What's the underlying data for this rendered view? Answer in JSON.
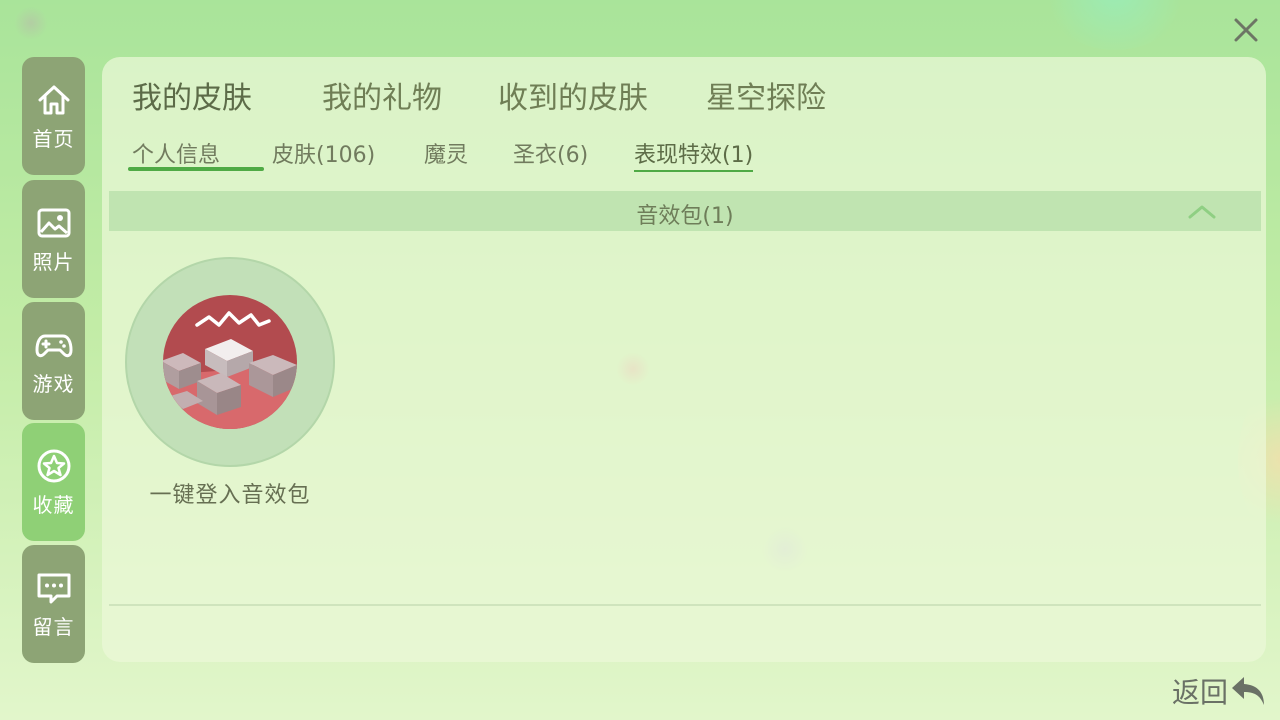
{
  "close_icon": "close-icon",
  "sidebar": {
    "items": [
      {
        "label": "首页",
        "icon": "home-icon"
      },
      {
        "label": "照片",
        "icon": "photo-icon"
      },
      {
        "label": "游戏",
        "icon": "gamepad-icon"
      },
      {
        "label": "收藏",
        "icon": "star-icon",
        "active": true
      },
      {
        "label": "留言",
        "icon": "message-icon"
      }
    ]
  },
  "tabs": [
    {
      "label": "我的皮肤",
      "active": true
    },
    {
      "label": "我的礼物"
    },
    {
      "label": "收到的皮肤"
    },
    {
      "label": "星空探险"
    }
  ],
  "subtabs": [
    {
      "label": "个人信息"
    },
    {
      "label": "皮肤(106)"
    },
    {
      "label": "魔灵"
    },
    {
      "label": "圣衣(6)"
    },
    {
      "label": "表现特效(1)",
      "active": true
    }
  ],
  "section": {
    "title": "音效包(1)",
    "icon": "chevron-up-icon"
  },
  "items": [
    {
      "label": "一键登入音效包",
      "icon": "sound-pack-icon"
    }
  ],
  "back": {
    "label": "返回",
    "icon": "back-arrow-icon"
  },
  "colors": {
    "accent": "#4faa45",
    "sidebar_bg": "#8da475",
    "sidebar_active_bg": "#8fd076",
    "section_bar": "#c0e4b1"
  }
}
